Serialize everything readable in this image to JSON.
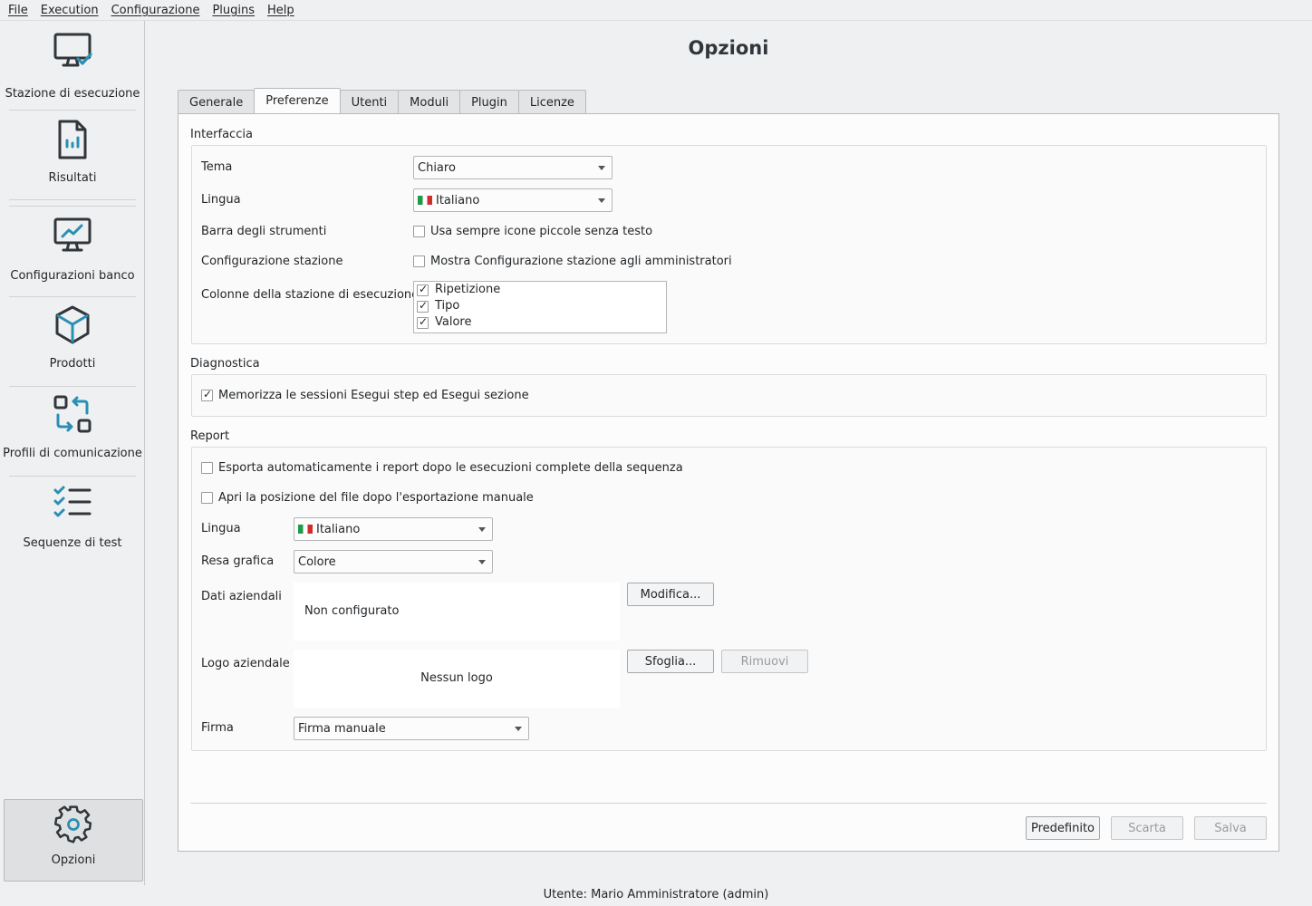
{
  "menu": [
    "File",
    "Execution",
    "Configurazione",
    "Plugins",
    "Help"
  ],
  "sidebar": {
    "items": [
      {
        "label": "Stazione di esecuzione",
        "icon": "monitor-check-icon"
      },
      {
        "label": "Risultati",
        "icon": "report-file-icon"
      },
      {
        "label": "Configurazioni banco",
        "icon": "monitor-chart-icon"
      },
      {
        "label": "Prodotti",
        "icon": "cube-icon"
      },
      {
        "label": "Profili di comunicazione",
        "icon": "exchange-icon"
      },
      {
        "label": "Sequenze di test",
        "icon": "checklist-icon"
      }
    ],
    "options": {
      "label": "Opzioni",
      "icon": "gear-icon",
      "selected": true
    }
  },
  "page_title": "Opzioni",
  "tabs": [
    "Generale",
    "Preferenze",
    "Utenti",
    "Moduli",
    "Plugin",
    "Licenze"
  ],
  "active_tab": "Preferenze",
  "interfaccia": {
    "title": "Interfaccia",
    "tema_label": "Tema",
    "tema_value": "Chiaro",
    "lingua_label": "Lingua",
    "lingua_value": "Italiano",
    "barra_label": "Barra degli strumenti",
    "barra_option": "Usa sempre icone piccole senza testo",
    "barra_checked": false,
    "config_label": "Configurazione stazione",
    "config_option": "Mostra Configurazione stazione agli amministratori",
    "config_checked": false,
    "colonne_label": "Colonne della stazione di esecuzione",
    "colonne": [
      {
        "label": "Ripetizione",
        "checked": true
      },
      {
        "label": "Tipo",
        "checked": true
      },
      {
        "label": "Valore",
        "checked": true
      }
    ]
  },
  "diagnostica": {
    "title": "Diagnostica",
    "option": "Memorizza le sessioni Esegui step ed Esegui sezione",
    "checked": true
  },
  "report": {
    "title": "Report",
    "esporta_option": "Esporta automaticamente i report dopo le esecuzioni complete della sequenza",
    "esporta_checked": false,
    "apri_option": "Apri la posizione del file dopo l'esportazione manuale",
    "apri_checked": false,
    "lingua_label": "Lingua",
    "lingua_value": "Italiano",
    "resa_label": "Resa grafica",
    "resa_value": "Colore",
    "dati_label": "Dati aziendali",
    "dati_value": "Non configurato",
    "modifica_button": "Modifica...",
    "logo_label": "Logo aziendale",
    "logo_value": "Nessun logo",
    "sfoglia_button": "Sfoglia...",
    "rimuovi_button": "Rimuovi",
    "firma_label": "Firma",
    "firma_value": "Firma manuale"
  },
  "footer_buttons": {
    "predefinito": "Predefinito",
    "scarta": "Scarta",
    "salva": "Salva"
  },
  "status_bar": "Utente: Mario Amministratore (admin)"
}
